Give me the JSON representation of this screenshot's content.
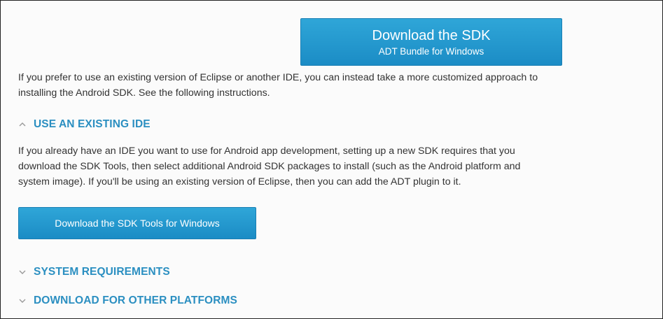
{
  "download_sdk": {
    "title": "Download the SDK",
    "subtitle": "ADT Bundle for Windows"
  },
  "intro": {
    "lines": [
      "If you prefer to use an existing version of Eclipse or another IDE, you can instead take a more customized approach to",
      "installing the Android SDK. See the following instructions."
    ]
  },
  "sections": {
    "existing_ide": {
      "label": "USE AN EXISTING IDE",
      "expanded": true,
      "icon": "chevron-up-icon",
      "body_lines": [
        "If you already have an IDE you want to use for Android app development, setting up a new SDK requires that you",
        "download the SDK Tools, then select additional Android SDK packages to install (such as the Android platform and",
        "system image). If you'll be using an existing version of Eclipse, then you can add the ADT plugin to it."
      ],
      "button_label": "Download the SDK Tools for Windows"
    },
    "system_requirements": {
      "label": "SYSTEM REQUIREMENTS",
      "expanded": false,
      "icon": "chevron-down-icon"
    },
    "other_platforms": {
      "label": "DOWNLOAD FOR OTHER PLATFORMS",
      "expanded": false,
      "icon": "chevron-down-icon"
    }
  },
  "colors": {
    "accent_blue": "#2b8fc1",
    "button_top": "#2fa6d8",
    "button_bottom": "#1b8cc5",
    "text": "#333333"
  }
}
